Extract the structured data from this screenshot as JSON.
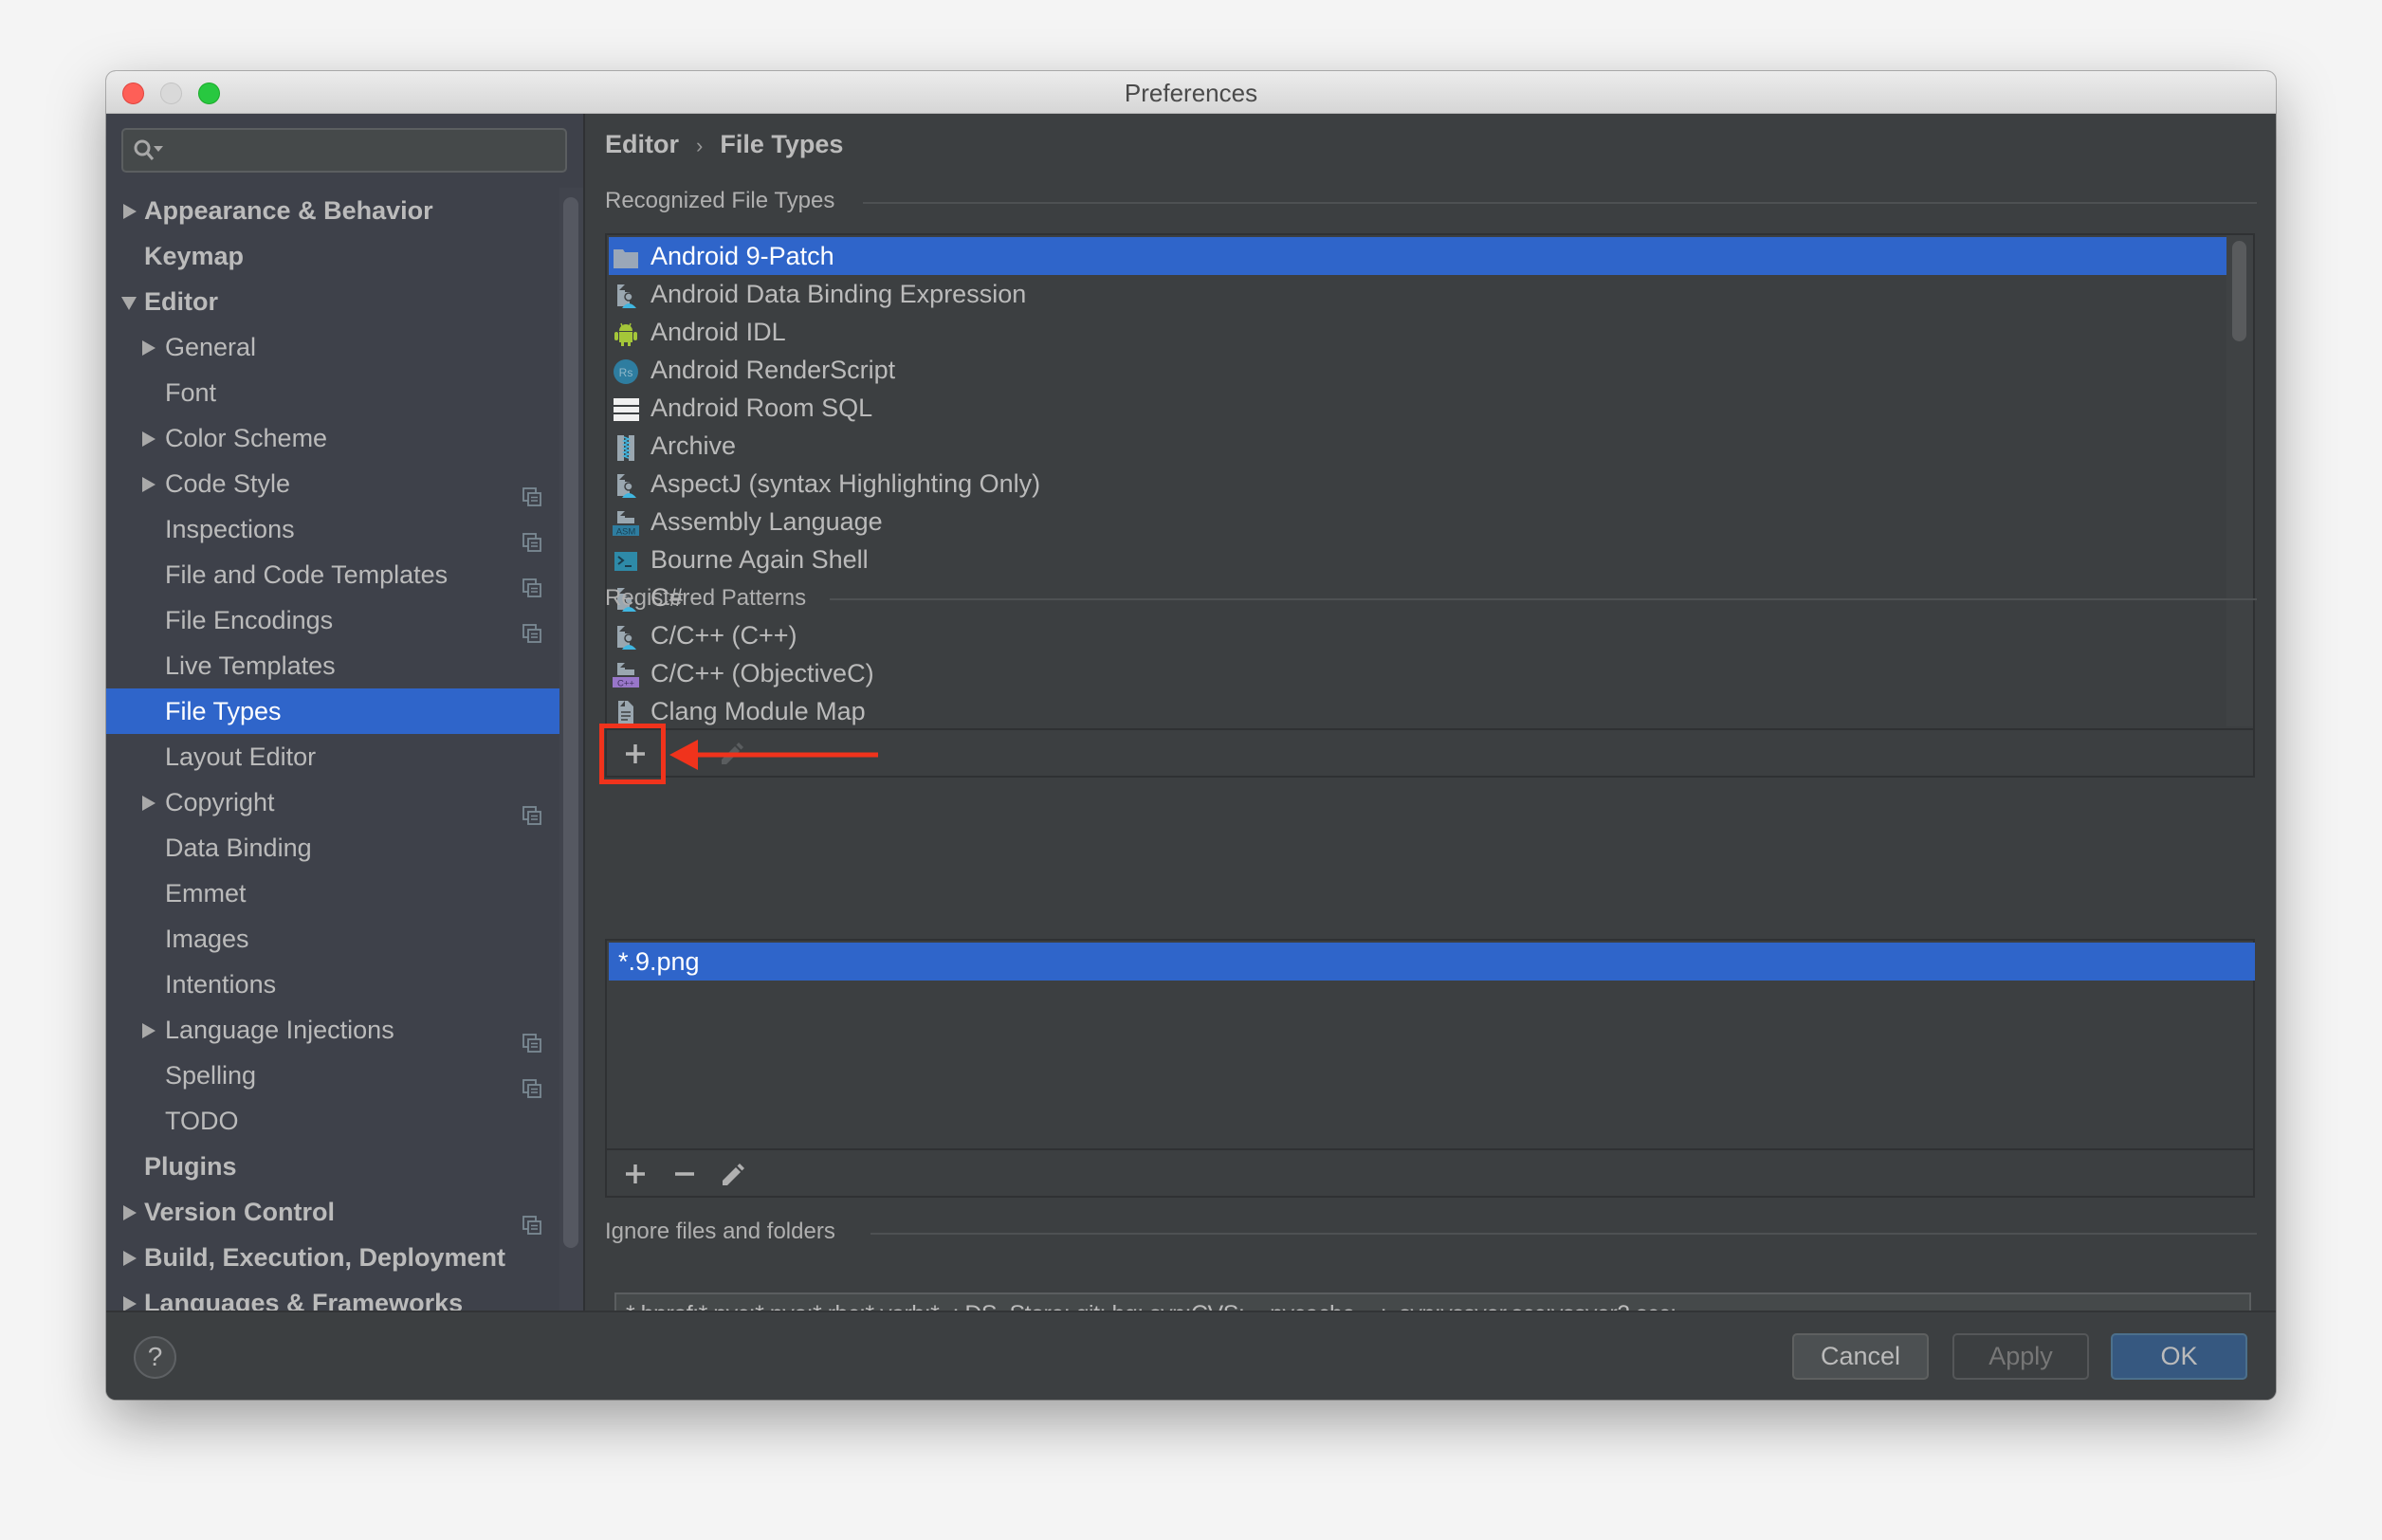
{
  "window": {
    "title": "Preferences"
  },
  "search": {
    "placeholder": "",
    "value": ""
  },
  "sidebar": {
    "items": [
      {
        "label": "Appearance & Behavior",
        "level": 0,
        "bold": true,
        "expandable": true,
        "expanded": false,
        "project_icon": false,
        "selected": false
      },
      {
        "label": "Keymap",
        "level": 0,
        "bold": true,
        "expandable": false,
        "expanded": false,
        "project_icon": false,
        "selected": false
      },
      {
        "label": "Editor",
        "level": 0,
        "bold": true,
        "expandable": true,
        "expanded": true,
        "project_icon": false,
        "selected": false
      },
      {
        "label": "General",
        "level": 1,
        "bold": false,
        "expandable": true,
        "expanded": false,
        "project_icon": false,
        "selected": false
      },
      {
        "label": "Font",
        "level": 1,
        "bold": false,
        "expandable": false,
        "expanded": false,
        "project_icon": false,
        "selected": false
      },
      {
        "label": "Color Scheme",
        "level": 1,
        "bold": false,
        "expandable": true,
        "expanded": false,
        "project_icon": false,
        "selected": false
      },
      {
        "label": "Code Style",
        "level": 1,
        "bold": false,
        "expandable": true,
        "expanded": false,
        "project_icon": true,
        "selected": false
      },
      {
        "label": "Inspections",
        "level": 1,
        "bold": false,
        "expandable": false,
        "expanded": false,
        "project_icon": true,
        "selected": false
      },
      {
        "label": "File and Code Templates",
        "level": 1,
        "bold": false,
        "expandable": false,
        "expanded": false,
        "project_icon": true,
        "selected": false
      },
      {
        "label": "File Encodings",
        "level": 1,
        "bold": false,
        "expandable": false,
        "expanded": false,
        "project_icon": true,
        "selected": false
      },
      {
        "label": "Live Templates",
        "level": 1,
        "bold": false,
        "expandable": false,
        "expanded": false,
        "project_icon": false,
        "selected": false
      },
      {
        "label": "File Types",
        "level": 1,
        "bold": false,
        "expandable": false,
        "expanded": false,
        "project_icon": false,
        "selected": true
      },
      {
        "label": "Layout Editor",
        "level": 1,
        "bold": false,
        "expandable": false,
        "expanded": false,
        "project_icon": false,
        "selected": false
      },
      {
        "label": "Copyright",
        "level": 1,
        "bold": false,
        "expandable": true,
        "expanded": false,
        "project_icon": true,
        "selected": false
      },
      {
        "label": "Data Binding",
        "level": 1,
        "bold": false,
        "expandable": false,
        "expanded": false,
        "project_icon": false,
        "selected": false
      },
      {
        "label": "Emmet",
        "level": 1,
        "bold": false,
        "expandable": false,
        "expanded": false,
        "project_icon": false,
        "selected": false
      },
      {
        "label": "Images",
        "level": 1,
        "bold": false,
        "expandable": false,
        "expanded": false,
        "project_icon": false,
        "selected": false
      },
      {
        "label": "Intentions",
        "level": 1,
        "bold": false,
        "expandable": false,
        "expanded": false,
        "project_icon": false,
        "selected": false
      },
      {
        "label": "Language Injections",
        "level": 1,
        "bold": false,
        "expandable": true,
        "expanded": false,
        "project_icon": true,
        "selected": false
      },
      {
        "label": "Spelling",
        "level": 1,
        "bold": false,
        "expandable": false,
        "expanded": false,
        "project_icon": true,
        "selected": false
      },
      {
        "label": "TODO",
        "level": 1,
        "bold": false,
        "expandable": false,
        "expanded": false,
        "project_icon": false,
        "selected": false
      },
      {
        "label": "Plugins",
        "level": 0,
        "bold": true,
        "expandable": false,
        "expanded": false,
        "project_icon": false,
        "selected": false
      },
      {
        "label": "Version Control",
        "level": 0,
        "bold": true,
        "expandable": true,
        "expanded": false,
        "project_icon": true,
        "selected": false
      },
      {
        "label": "Build, Execution, Deployment",
        "level": 0,
        "bold": true,
        "expandable": true,
        "expanded": false,
        "project_icon": false,
        "selected": false
      },
      {
        "label": "Languages & Frameworks",
        "level": 0,
        "bold": true,
        "expandable": true,
        "expanded": false,
        "project_icon": false,
        "selected": false
      }
    ]
  },
  "breadcrumb": {
    "parent": "Editor",
    "separator": "›",
    "current": "File Types"
  },
  "recognized": {
    "label": "Recognized File Types",
    "items": [
      {
        "label": "Android 9-Patch",
        "icon": "folder-icon",
        "selected": true
      },
      {
        "label": "Android Data Binding Expression",
        "icon": "custom-file-icon",
        "selected": false
      },
      {
        "label": "Android IDL",
        "icon": "android-icon",
        "selected": false
      },
      {
        "label": "Android RenderScript",
        "icon": "renderscript-icon",
        "selected": false
      },
      {
        "label": "Android Room SQL",
        "icon": "table-icon",
        "selected": false
      },
      {
        "label": "Archive",
        "icon": "archive-icon",
        "selected": false
      },
      {
        "label": "AspectJ (syntax Highlighting Only)",
        "icon": "custom-file-icon",
        "selected": false
      },
      {
        "label": "Assembly Language",
        "icon": "asm-file-icon",
        "selected": false
      },
      {
        "label": "Bourne Again Shell",
        "icon": "shell-icon",
        "selected": false
      },
      {
        "label": "C#",
        "icon": "custom-file-icon",
        "selected": false
      },
      {
        "label": "C/C++ (C++)",
        "icon": "custom-file-icon",
        "selected": false
      },
      {
        "label": "C/C++ (ObjectiveC)",
        "icon": "cpp-file-icon",
        "selected": false
      },
      {
        "label": "Clang Module Map",
        "icon": "text-file-icon",
        "selected": false
      }
    ],
    "toolbar": {
      "add": "+",
      "edit_disabled": true
    }
  },
  "patterns": {
    "label": "Registered Patterns",
    "items": [
      {
        "label": "*.9.png",
        "selected": true
      }
    ],
    "toolbar": {
      "add": "+",
      "remove": "−"
    }
  },
  "ignore": {
    "label": "Ignore files and folders",
    "value": "*.hprof;*.pyc;*.pyo;*.rbc;*.yarb;*~;.DS_Store;.git;.hg;.svn;CVS;__pycache__;_svn;vssver.scc;vssver2.scc;"
  },
  "footer": {
    "help": "?",
    "cancel": "Cancel",
    "apply": "Apply",
    "ok": "OK",
    "apply_enabled": false
  },
  "annotation": {
    "highlight_target": "add-file-type-button",
    "color": "#f0331c"
  },
  "colors": {
    "selection": "#2f65ca",
    "background": "#3c3f41",
    "sidebar": "#3e414a",
    "ok_button": "#365880"
  }
}
